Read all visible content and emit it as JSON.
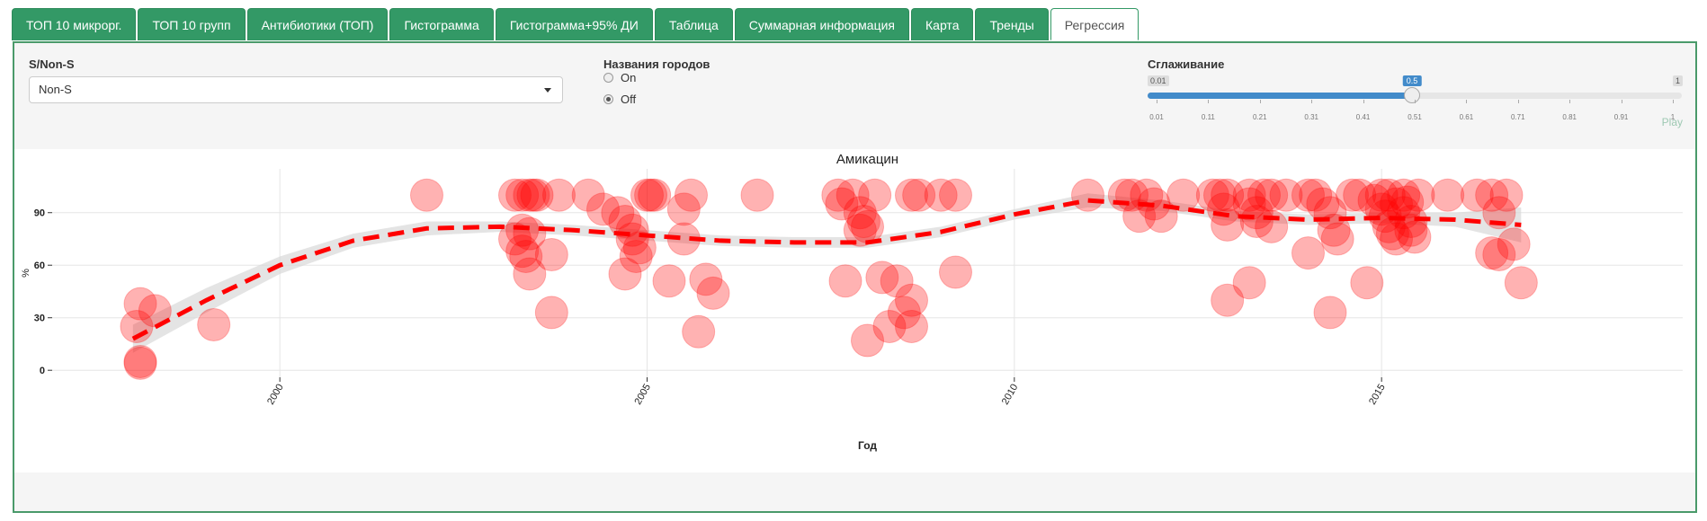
{
  "tabs": [
    {
      "label": "ТОП 10 микрорг."
    },
    {
      "label": "ТОП 10 групп"
    },
    {
      "label": "Антибиотики (ТОП)"
    },
    {
      "label": "Гистограмма"
    },
    {
      "label": "Гистограмма+95% ДИ"
    },
    {
      "label": "Таблица"
    },
    {
      "label": "Суммарная информация"
    },
    {
      "label": "Карта"
    },
    {
      "label": "Тренды"
    },
    {
      "label": "Регрессия"
    }
  ],
  "active_tab": "Регрессия",
  "controls": {
    "sns_label": "S/Non-S",
    "sns_value": "Non-S",
    "cities_label": "Названия городов",
    "radio_on": "On",
    "radio_off": "Off",
    "radio_selected": "Off",
    "smooth_label": "Сглаживание",
    "smooth_min": "0.01",
    "smooth_max": "1",
    "smooth_value": "0.5",
    "smooth_fraction": 0.495,
    "smooth_ticks": [
      "0.01",
      "0.11",
      "0.21",
      "0.31",
      "0.41",
      "0.51",
      "0.61",
      "0.71",
      "0.81",
      "0.91",
      "1"
    ],
    "play_label": "Play"
  },
  "colors": {
    "tab_green": "#339966",
    "point_red": "#ff0000",
    "line_red": "#ff0000",
    "band_gray": "#d9d9d9",
    "slider_blue": "#428bca"
  },
  "chart_data": {
    "type": "scatter",
    "title": "Амикацин",
    "xlabel": "Год",
    "ylabel": "%",
    "xlim": [
      1996.9,
      2019.1
    ],
    "ylim": [
      -4,
      115
    ],
    "x_ticks": [
      2000,
      2005,
      2010,
      2015
    ],
    "y_ticks": [
      0,
      30,
      60,
      90
    ],
    "grid": true,
    "points": [
      [
        1998.1,
        38
      ],
      [
        1998.05,
        25
      ],
      [
        1998.1,
        5
      ],
      [
        1998.1,
        4
      ],
      [
        1998.3,
        34
      ],
      [
        1999.1,
        26
      ],
      [
        2002.0,
        100
      ],
      [
        2003.2,
        100
      ],
      [
        2003.3,
        100
      ],
      [
        2003.4,
        100
      ],
      [
        2003.45,
        100
      ],
      [
        2003.5,
        100
      ],
      [
        2003.8,
        100
      ],
      [
        2003.3,
        80
      ],
      [
        2003.4,
        78
      ],
      [
        2003.2,
        75
      ],
      [
        2003.3,
        68
      ],
      [
        2003.35,
        65
      ],
      [
        2003.4,
        55
      ],
      [
        2003.7,
        66
      ],
      [
        2003.7,
        33
      ],
      [
        2004.2,
        100
      ],
      [
        2004.4,
        92
      ],
      [
        2004.6,
        90
      ],
      [
        2004.7,
        85
      ],
      [
        2004.8,
        80
      ],
      [
        2004.8,
        75
      ],
      [
        2004.85,
        65
      ],
      [
        2004.7,
        55
      ],
      [
        2005.0,
        100
      ],
      [
        2005.05,
        100
      ],
      [
        2005.1,
        100
      ],
      [
        2004.9,
        70
      ],
      [
        2005.3,
        51
      ],
      [
        2005.6,
        100
      ],
      [
        2005.5,
        92
      ],
      [
        2005.5,
        75
      ],
      [
        2005.8,
        52
      ],
      [
        2005.9,
        44
      ],
      [
        2005.7,
        22
      ],
      [
        2006.5,
        100
      ],
      [
        2007.6,
        100
      ],
      [
        2007.65,
        95
      ],
      [
        2007.8,
        100
      ],
      [
        2007.9,
        90
      ],
      [
        2007.95,
        85
      ],
      [
        2008.1,
        100
      ],
      [
        2007.9,
        80
      ],
      [
        2008.0,
        82
      ],
      [
        2007.7,
        51
      ],
      [
        2008.0,
        17
      ],
      [
        2008.2,
        53
      ],
      [
        2008.4,
        51
      ],
      [
        2008.3,
        25
      ],
      [
        2008.6,
        40
      ],
      [
        2008.5,
        33
      ],
      [
        2008.6,
        25
      ],
      [
        2008.6,
        100
      ],
      [
        2008.7,
        100
      ],
      [
        2009.0,
        100
      ],
      [
        2009.2,
        100
      ],
      [
        2009.2,
        56
      ],
      [
        2011.0,
        100
      ],
      [
        2011.5,
        100
      ],
      [
        2011.6,
        100
      ],
      [
        2011.7,
        88
      ],
      [
        2011.8,
        100
      ],
      [
        2011.9,
        95
      ],
      [
        2012.0,
        88
      ],
      [
        2012.3,
        100
      ],
      [
        2012.7,
        100
      ],
      [
        2012.8,
        100
      ],
      [
        2012.9,
        100
      ],
      [
        2012.85,
        92
      ],
      [
        2012.9,
        83
      ],
      [
        2012.9,
        40
      ],
      [
        2013.2,
        100
      ],
      [
        2013.2,
        95
      ],
      [
        2013.3,
        90
      ],
      [
        2013.3,
        85
      ],
      [
        2013.4,
        100
      ],
      [
        2013.5,
        82
      ],
      [
        2013.5,
        100
      ],
      [
        2013.7,
        100
      ],
      [
        2013.2,
        50
      ],
      [
        2014.0,
        100
      ],
      [
        2014.1,
        100
      ],
      [
        2014.2,
        95
      ],
      [
        2014.3,
        90
      ],
      [
        2014.35,
        80
      ],
      [
        2014.4,
        75
      ],
      [
        2014.3,
        33
      ],
      [
        2014.0,
        67
      ],
      [
        2014.6,
        100
      ],
      [
        2014.7,
        100
      ],
      [
        2014.8,
        50
      ],
      [
        2015.0,
        100
      ],
      [
        2015.1,
        100
      ],
      [
        2015.2,
        95
      ],
      [
        2015.3,
        90
      ],
      [
        2015.4,
        85
      ],
      [
        2014.9,
        97
      ],
      [
        2015.0,
        92
      ],
      [
        2015.05,
        88
      ],
      [
        2015.1,
        82
      ],
      [
        2015.15,
        78
      ],
      [
        2015.2,
        75
      ],
      [
        2015.3,
        100
      ],
      [
        2015.35,
        96
      ],
      [
        2015.4,
        80
      ],
      [
        2015.45,
        76
      ],
      [
        2015.5,
        100
      ],
      [
        2015.9,
        100
      ],
      [
        2016.3,
        100
      ],
      [
        2016.5,
        100
      ],
      [
        2016.7,
        100
      ],
      [
        2016.6,
        90
      ],
      [
        2016.5,
        67
      ],
      [
        2016.6,
        66
      ],
      [
        2016.8,
        72
      ],
      [
        2016.9,
        50
      ]
    ],
    "trend": {
      "x": [
        1998.0,
        1999.0,
        2000.0,
        2001.0,
        2002.0,
        2003.0,
        2004.0,
        2005.0,
        2006.0,
        2007.0,
        2008.0,
        2009.0,
        2010.0,
        2011.0,
        2012.0,
        2013.0,
        2014.0,
        2015.0,
        2016.0,
        2016.9
      ],
      "y": [
        18,
        40,
        60,
        74,
        81,
        82,
        80,
        77,
        74,
        73,
        73,
        79,
        89,
        97,
        94,
        88,
        86,
        87,
        86,
        83
      ],
      "lower": [
        10,
        33,
        55,
        70,
        77,
        79,
        77,
        74,
        71,
        70,
        70,
        76,
        86,
        93,
        91,
        85,
        83,
        84,
        82,
        73
      ],
      "upper": [
        26,
        47,
        65,
        78,
        85,
        85,
        83,
        80,
        77,
        76,
        76,
        82,
        92,
        101,
        97,
        91,
        89,
        90,
        90,
        93
      ]
    }
  }
}
